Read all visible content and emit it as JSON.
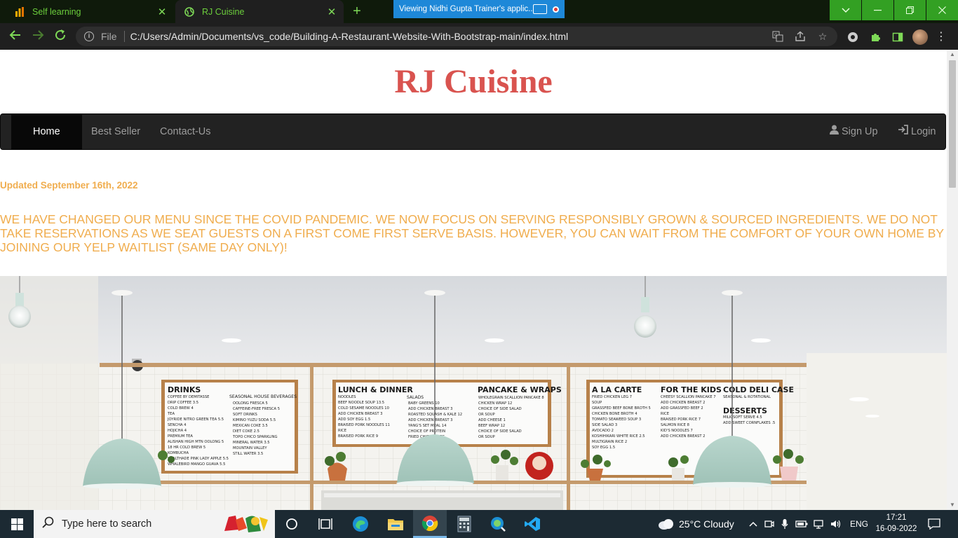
{
  "browser": {
    "tabs": [
      {
        "title": "Self learning",
        "icon": "analytics-icon"
      },
      {
        "title": "RJ Cuisine",
        "icon": "globe-icon"
      }
    ],
    "screen_share_banner": "Viewing Nidhi Gupta Trainer's applic...",
    "omnibox": {
      "scheme": "File",
      "url": "C:/Users/Admin/Documents/vs_code/Building-A-Restaurant-Website-With-Bootstrap-main/index.html"
    }
  },
  "page": {
    "site_title": "RJ Cuisine",
    "nav": {
      "items": [
        "Home",
        "Best Seller",
        "Contact-Us"
      ],
      "active": "Home",
      "signup_label": "Sign Up",
      "login_label": "Login"
    },
    "updated_text": "Updated September 16th, 2022",
    "notice_text": "WE HAVE CHANGED OUR MENU SINCE THE COVID PANDEMIC. WE NOW FOCUS ON SERVING RESPONSIBLY GROWN & SOURCED INGREDIENTS. WE DO NOT TAKE RESERVATIONS AS WE SEAT GUESTS ON A FIRST COME FIRST SERVE BASIS. HOWEVER, YOU CAN WAIT FROM THE COMFORT OF YOUR OWN HOME BY JOINING OUR YELP WAITLIST (SAME DAY ONLY)!",
    "hero": {
      "boards": [
        {
          "headings": [
            "DRINKS"
          ],
          "lines": [
            "COFFEE BY DEMITASSE",
            "DRIP COFFEE 3.5",
            "COLD BREW 4",
            "TEA",
            "JOYRIDE NITRO GREEN TEA 5.5",
            "SENCHA 4",
            "HOJICHA 4",
            "PREMIUM TEA",
            "ALISHAN HIGH MTN OOLONG 5",
            "18 HR COLD BREW 5",
            "KOMBUCHA",
            "HEALTHADE PINK LADY APPLE 5.5",
            "WHALEBIRD MANGO GUAVA 5.5"
          ]
        },
        {
          "headings": [
            "SEASONAL HOUSE BEVERAGES"
          ],
          "lines": [
            "OOLONG FRESCA 5",
            "CAFFEINE-FREE FRESCA 5",
            "SOFT DRINKS",
            "KIMINO YUZU SODA 5.5",
            "MEXICAN COKE 3.5",
            "DIET COKE 2.5",
            "TOPO CHICO SPARKLING",
            "MINERAL WATER 3.5",
            "MOUNTAIN VALLEY",
            "STILL WATER 3.5"
          ]
        },
        {
          "headings": [
            "LUNCH & DINNER"
          ],
          "lines": [
            "NOODLES",
            "BEEF NOODLE SOUP 13.5",
            "COLD SESAME NOODLES 10",
            "ADD CHICKEN BREAST 3",
            "ADD SOY EGG 1.5",
            "BRAISED PORK NOODLES 11",
            "RICE",
            "BRAISED PORK RICE 9",
            "WHITE OR MULTIGRAIN"
          ]
        },
        {
          "headings": [
            "SALADS"
          ],
          "lines": [
            "BABY GREENS 10",
            "ADD CHICKEN BREAST 3",
            "ROASTED SQUASH & KALE 12",
            "ADD CHICKEN BREAST 3",
            "YANG'S SET MEAL 14",
            "CHOICE OF PROTEIN",
            "FRIED CHICKEN LEG"
          ]
        },
        {
          "headings": [
            "PANCAKE & WRAPS"
          ],
          "lines": [
            "WHOLEGRAIN SCALLION PANCAKE 8",
            "CHICKEN WRAP 12",
            "CHOICE OF SIDE SALAD",
            "OR SOUP",
            "ADD CHEESE 1",
            "BEEF WRAP 12",
            "CHOICE OF SIDE SALAD",
            "OR SOUP"
          ]
        },
        {
          "headings": [
            "A LA CARTE"
          ],
          "lines": [
            "FRIED CHICKEN LEG 7",
            "SOUP",
            "GRASSFED BEEF BONE BROTH 5",
            "CHICKEN BONE BROTH 4",
            "TOMATO SEAWEED SOUP 3",
            "SIDE SALAD 3",
            "AVOCADO 2",
            "KOSHIHIKARI WHITE RICE 2.5",
            "MULTIGRAIN RICE 2",
            "SOY EGG 1.5"
          ]
        },
        {
          "headings": [
            "FOR THE KIDS"
          ],
          "lines": [
            "CHEESY SCALLION PANCAKE 7",
            "ADD CHICKEN BREAST 2",
            "ADD GRASSFED BEEF 2",
            "RICE",
            "BRAISED PORK RICE 7",
            "SALMON RICE 8",
            "KID'S NOODLES 7",
            "ADD CHICKEN BREAST 2"
          ]
        },
        {
          "headings": [
            "COLD DELI CASE",
            "DESSERTS"
          ],
          "lines": [
            "SEASONAL & ROTATIONAL",
            "MILK SOFT SERVE 4.5",
            "ADD SWEET CORNFLAKES .5"
          ]
        }
      ]
    }
  },
  "taskbar": {
    "search_placeholder": "Type here to search",
    "weather": "25°C  Cloudy",
    "language": "ENG",
    "time": "17:21",
    "date": "16-09-2022"
  }
}
